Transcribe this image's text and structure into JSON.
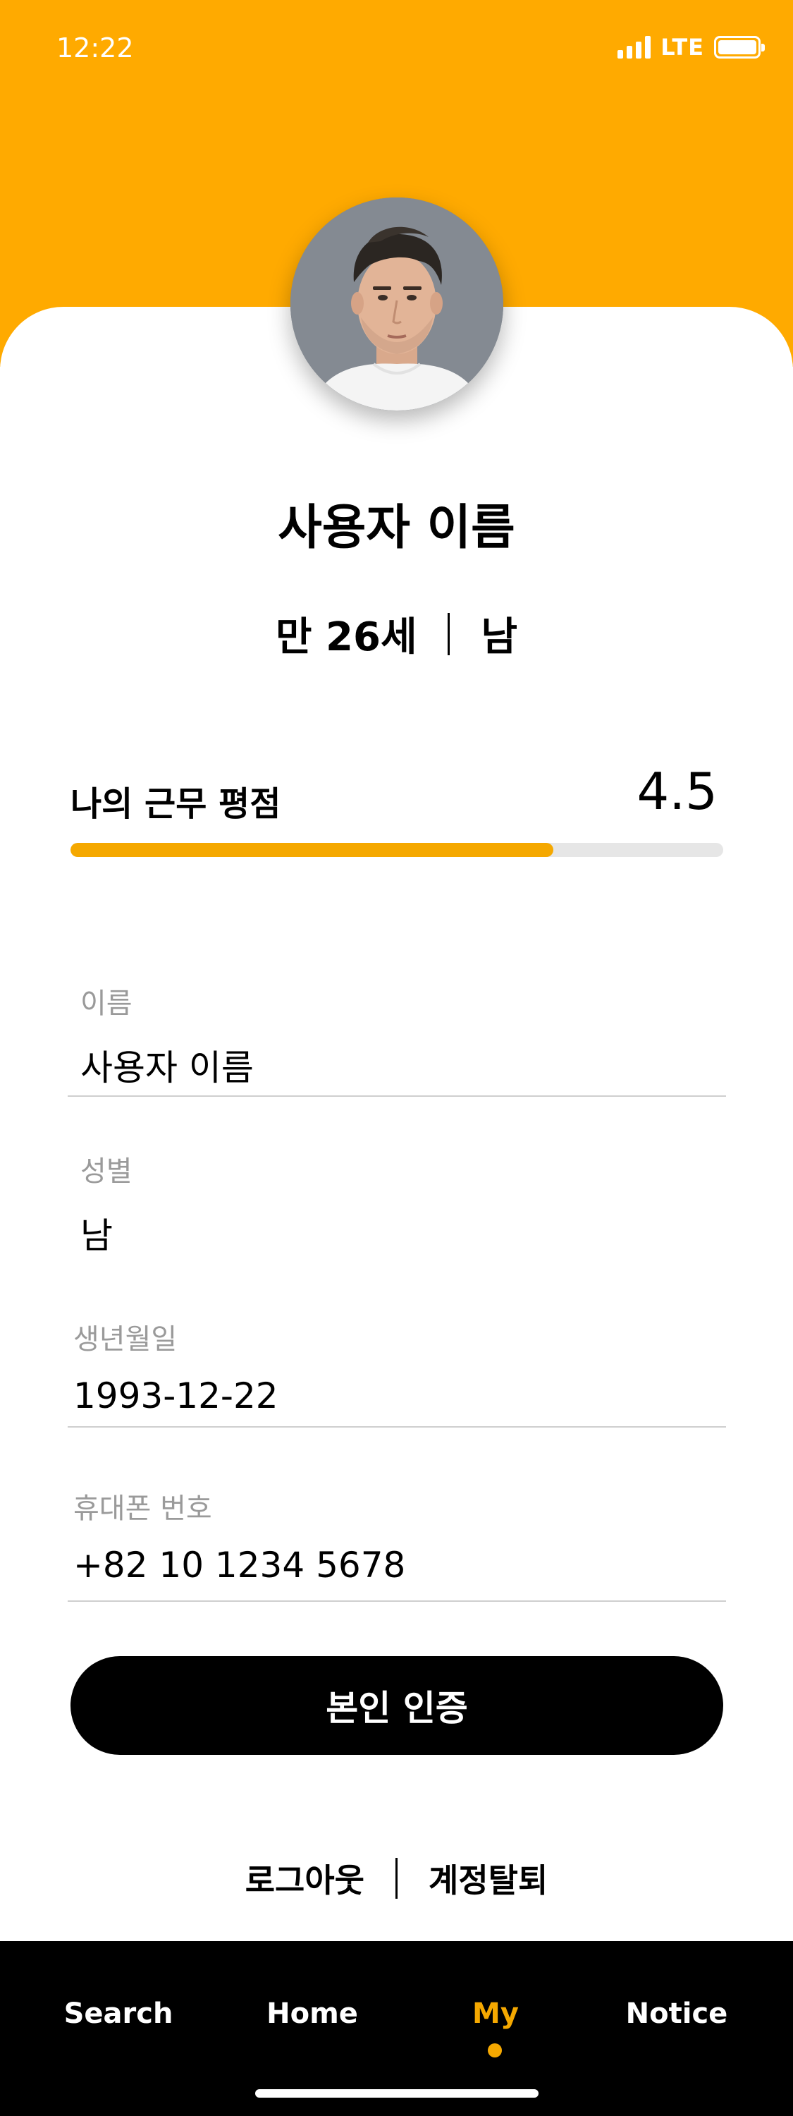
{
  "status": {
    "time": "12:22",
    "network": "LTE"
  },
  "profile": {
    "name": "사용자 이름",
    "age": "만 26세",
    "gender": "남"
  },
  "rating": {
    "label": "나의 근무 평점",
    "value": "4.5",
    "fill_fraction": 0.74,
    "color": "#F5A800"
  },
  "fields": [
    {
      "label": "이름",
      "value": "사용자 이름"
    },
    {
      "label": "성별",
      "value": "남"
    },
    {
      "label": "생년월일",
      "value": "1993-12-22"
    },
    {
      "label": "휴대폰 번호",
      "value": "+82 10 1234 5678"
    }
  ],
  "actions": {
    "verify_label": "본인 인증",
    "logout_label": "로그아웃",
    "delete_account_label": "계정탈퇴"
  },
  "nav": {
    "items": [
      {
        "label": "Search",
        "active": false
      },
      {
        "label": "Home",
        "active": false
      },
      {
        "label": "My",
        "active": true
      },
      {
        "label": "Notice",
        "active": false
      }
    ]
  },
  "colors": {
    "header": "#FFAA00",
    "accent": "#F5A800",
    "nav_bg": "#000000"
  },
  "icons": [
    "signal-icon",
    "battery-icon",
    "avatar-photo",
    "active-dot-icon"
  ]
}
